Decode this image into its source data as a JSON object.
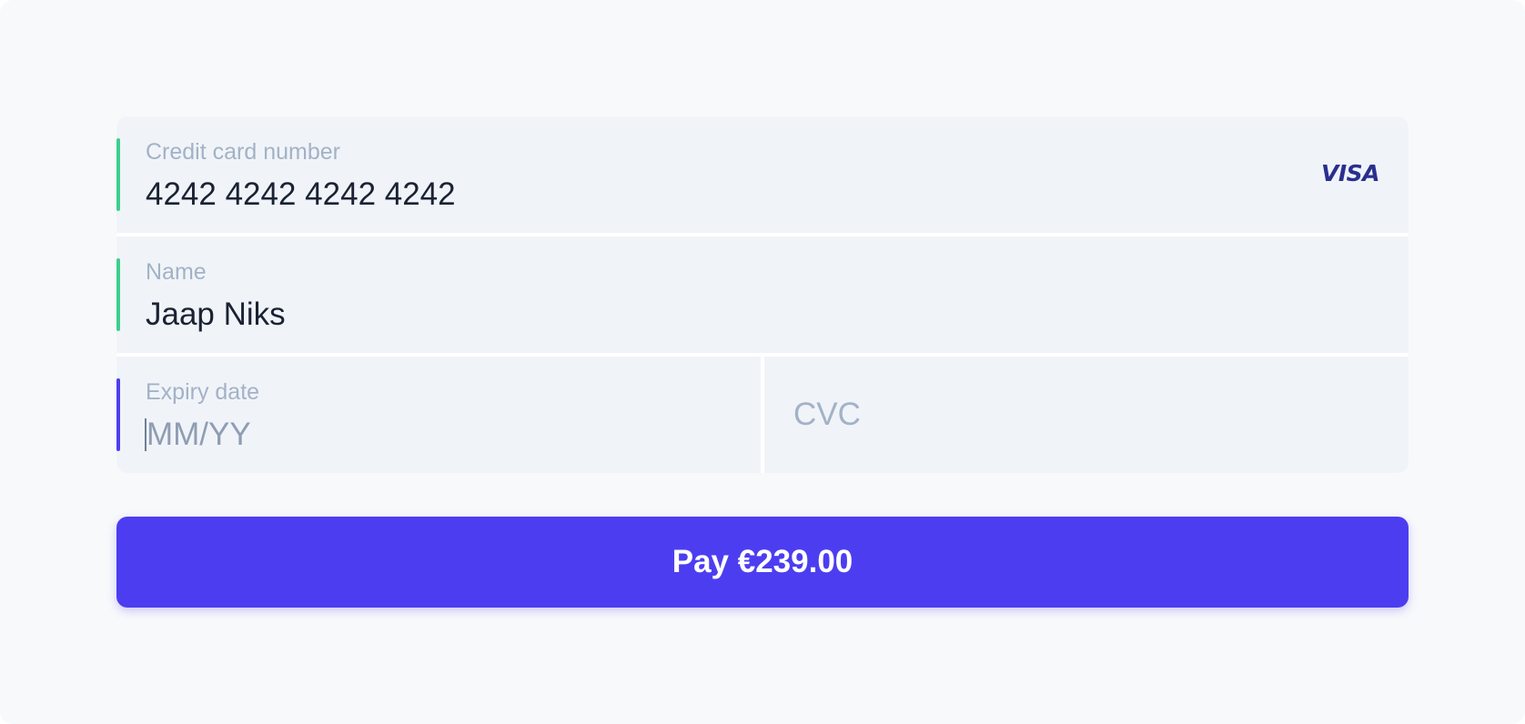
{
  "card_number": {
    "label": "Credit card number",
    "value": "4242 4242 4242 4242",
    "brand": "VISA",
    "status_color": "#3ecf8e"
  },
  "name": {
    "label": "Name",
    "value": "Jaap Niks",
    "status_color": "#3ecf8e"
  },
  "expiry": {
    "label": "Expiry date",
    "placeholder": "MM/YY",
    "focus_color": "#4f3ff0"
  },
  "cvc": {
    "placeholder": "CVC"
  },
  "pay_button": {
    "label": "Pay €239.00",
    "color": "#4c3ef0"
  }
}
